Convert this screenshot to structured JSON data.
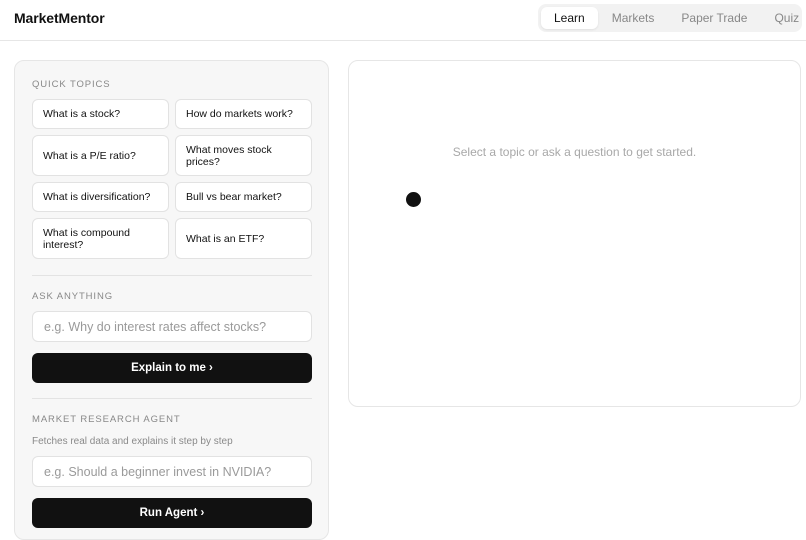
{
  "app": {
    "brand": "MarketMentor"
  },
  "nav": {
    "tabs": [
      {
        "label": "Learn",
        "active": true
      },
      {
        "label": "Markets",
        "active": false
      },
      {
        "label": "Paper Trade",
        "active": false
      },
      {
        "label": "Quiz",
        "active": false
      }
    ]
  },
  "quick_topics": {
    "heading": "QUICK TOPICS",
    "chips": [
      "What is a stock?",
      "How do markets work?",
      "What is a P/E ratio?",
      "What moves stock prices?",
      "What is diversification?",
      "Bull vs bear market?",
      "What is compound interest?",
      "What is an ETF?"
    ]
  },
  "ask": {
    "heading": "ASK ANYTHING",
    "placeholder": "e.g. Why do interest rates affect stocks?",
    "button_label": "Explain to me ›"
  },
  "agent": {
    "heading": "MARKET RESEARCH AGENT",
    "description": "Fetches real data and explains it step by step",
    "placeholder": "e.g. Should a beginner invest in NVIDIA?",
    "button_label": "Run Agent ›"
  },
  "content": {
    "empty_message": "Select a topic or ask a question to get started."
  },
  "colors": {
    "accent": "#111111",
    "panel_bg": "#f7f7f7",
    "border": "#e6e6e6"
  }
}
